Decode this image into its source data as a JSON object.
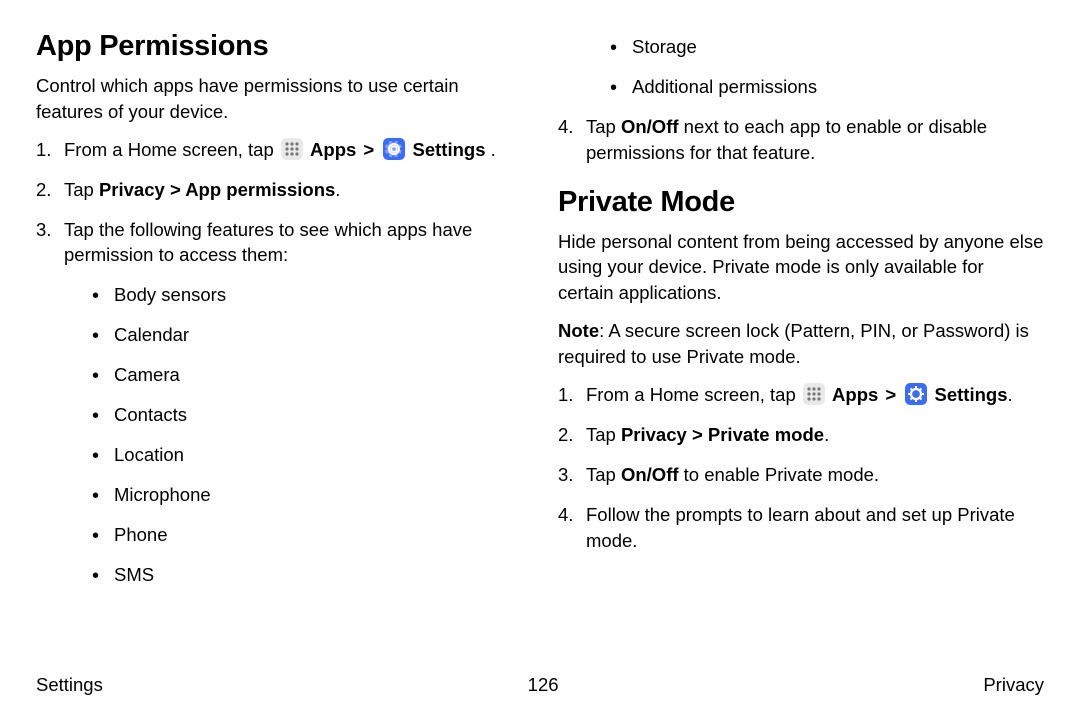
{
  "left": {
    "title": "App Permissions",
    "intro": "Control which apps have permissions to use certain features of your device.",
    "step1_prefix": "From a Home screen, tap ",
    "apps_label": "Apps",
    "settings_label": "Settings",
    "step1_suffix": " .",
    "step2_prefix": "Tap ",
    "step2_bold": "Privacy > App permissions",
    "step2_suffix": ".",
    "step3": "Tap the following features to see which apps have permission to access them:",
    "features": [
      "Body sensors",
      "Calendar",
      "Camera",
      "Contacts",
      "Location",
      "Microphone",
      "Phone",
      "SMS"
    ]
  },
  "right": {
    "extra_features": [
      "Storage",
      "Additional permissions"
    ],
    "step4_prefix": "Tap ",
    "step4_bold": "On/Off",
    "step4_rest": " next to each app to enable or disable permissions for that feature.",
    "title": "Private Mode",
    "intro": "Hide personal content from being accessed by anyone else using your device. Private mode is only available for certain applications.",
    "note_label": "Note",
    "note_rest": ": A secure screen lock (Pattern, PIN, or Password) is required to use Private mode.",
    "pm_step1_prefix": "From a Home screen, tap ",
    "apps_label": "Apps",
    "settings_label": "Settings",
    "pm_step1_suffix": ".",
    "pm_step2_prefix": "Tap ",
    "pm_step2_bold": "Privacy > Private mode",
    "pm_step2_suffix": ".",
    "pm_step3_prefix": "Tap ",
    "pm_step3_bold": "On/Off",
    "pm_step3_rest": " to enable Private mode.",
    "pm_step4": "Follow the prompts to learn about and set up Private mode."
  },
  "footer": {
    "left": "Settings",
    "center": "126",
    "right": "Privacy"
  }
}
